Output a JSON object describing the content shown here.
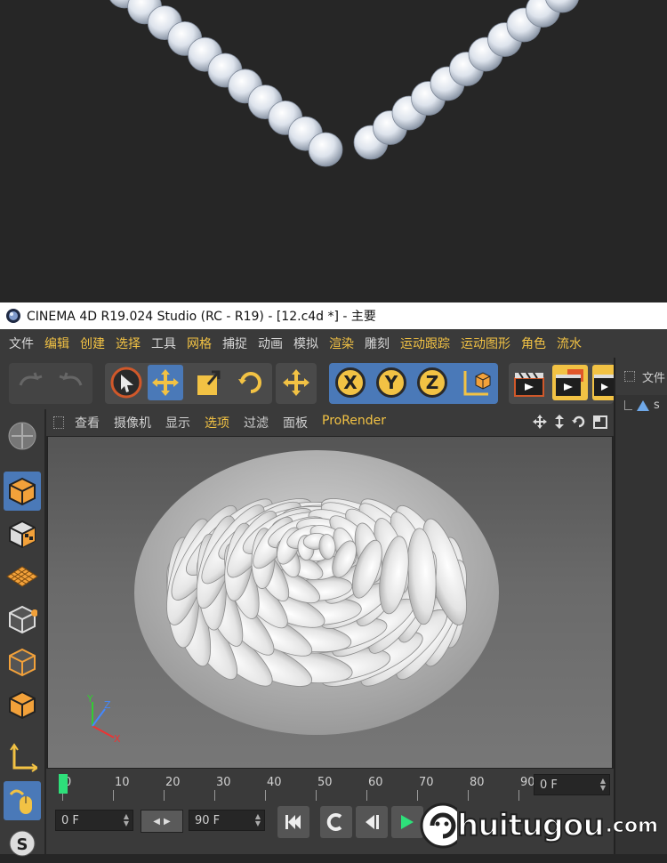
{
  "window": {
    "title": "CINEMA 4D R19.024 Studio (RC - R19) - [12.c4d *] - 主要"
  },
  "menu": {
    "items": [
      "文件",
      "编辑",
      "创建",
      "选择",
      "工具",
      "网格",
      "捕捉",
      "动画",
      "模拟",
      "渲染",
      "雕刻",
      "运动跟踪",
      "运动图形",
      "角色",
      "流水"
    ],
    "accent_items": [
      "编辑",
      "创建",
      "选择",
      "网格",
      "渲染",
      "运动跟踪",
      "运动图形",
      "角色",
      "流水"
    ]
  },
  "toolbar": {
    "axis_x": "X",
    "axis_y": "Y",
    "axis_z": "Z"
  },
  "viewport_menu": {
    "items": [
      "查看",
      "摄像机",
      "显示",
      "选项",
      "过滤",
      "面板",
      "ProRender"
    ],
    "accent_items": [
      "选项",
      "ProRender"
    ]
  },
  "right_panel": {
    "header": "文件",
    "object_label": "s"
  },
  "axis_gizmo": {
    "x": "X",
    "y": "Y",
    "z": "Z"
  },
  "timeline": {
    "ticks": [
      "0",
      "10",
      "20",
      "30",
      "40",
      "50",
      "60",
      "70",
      "80",
      "90"
    ],
    "current_frame_field": "0 F"
  },
  "controls": {
    "start_field": "0 F",
    "end_field": "90 F"
  },
  "watermark": {
    "text": "huitugou",
    "suffix": ".com"
  },
  "colors": {
    "accent": "#f2c244",
    "active_blue": "#4a79b8",
    "background": "#262626",
    "panel": "#3a3a3a"
  }
}
